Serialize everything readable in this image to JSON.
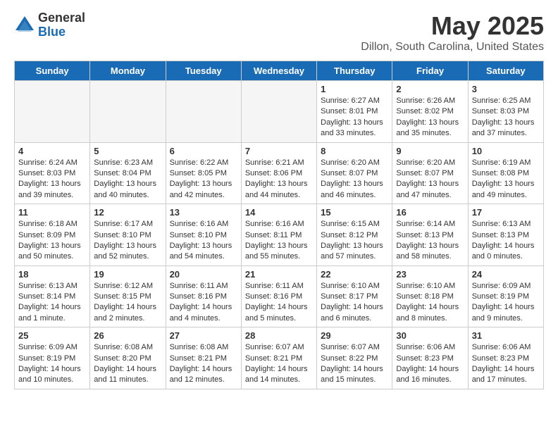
{
  "logo": {
    "general": "General",
    "blue": "Blue"
  },
  "header": {
    "title": "May 2025",
    "subtitle": "Dillon, South Carolina, United States"
  },
  "weekdays": [
    "Sunday",
    "Monday",
    "Tuesday",
    "Wednesday",
    "Thursday",
    "Friday",
    "Saturday"
  ],
  "weeks": [
    [
      {
        "day": "",
        "detail": ""
      },
      {
        "day": "",
        "detail": ""
      },
      {
        "day": "",
        "detail": ""
      },
      {
        "day": "",
        "detail": ""
      },
      {
        "day": "1",
        "detail": "Sunrise: 6:27 AM\nSunset: 8:01 PM\nDaylight: 13 hours\nand 33 minutes."
      },
      {
        "day": "2",
        "detail": "Sunrise: 6:26 AM\nSunset: 8:02 PM\nDaylight: 13 hours\nand 35 minutes."
      },
      {
        "day": "3",
        "detail": "Sunrise: 6:25 AM\nSunset: 8:03 PM\nDaylight: 13 hours\nand 37 minutes."
      }
    ],
    [
      {
        "day": "4",
        "detail": "Sunrise: 6:24 AM\nSunset: 8:03 PM\nDaylight: 13 hours\nand 39 minutes."
      },
      {
        "day": "5",
        "detail": "Sunrise: 6:23 AM\nSunset: 8:04 PM\nDaylight: 13 hours\nand 40 minutes."
      },
      {
        "day": "6",
        "detail": "Sunrise: 6:22 AM\nSunset: 8:05 PM\nDaylight: 13 hours\nand 42 minutes."
      },
      {
        "day": "7",
        "detail": "Sunrise: 6:21 AM\nSunset: 8:06 PM\nDaylight: 13 hours\nand 44 minutes."
      },
      {
        "day": "8",
        "detail": "Sunrise: 6:20 AM\nSunset: 8:07 PM\nDaylight: 13 hours\nand 46 minutes."
      },
      {
        "day": "9",
        "detail": "Sunrise: 6:20 AM\nSunset: 8:07 PM\nDaylight: 13 hours\nand 47 minutes."
      },
      {
        "day": "10",
        "detail": "Sunrise: 6:19 AM\nSunset: 8:08 PM\nDaylight: 13 hours\nand 49 minutes."
      }
    ],
    [
      {
        "day": "11",
        "detail": "Sunrise: 6:18 AM\nSunset: 8:09 PM\nDaylight: 13 hours\nand 50 minutes."
      },
      {
        "day": "12",
        "detail": "Sunrise: 6:17 AM\nSunset: 8:10 PM\nDaylight: 13 hours\nand 52 minutes."
      },
      {
        "day": "13",
        "detail": "Sunrise: 6:16 AM\nSunset: 8:10 PM\nDaylight: 13 hours\nand 54 minutes."
      },
      {
        "day": "14",
        "detail": "Sunrise: 6:16 AM\nSunset: 8:11 PM\nDaylight: 13 hours\nand 55 minutes."
      },
      {
        "day": "15",
        "detail": "Sunrise: 6:15 AM\nSunset: 8:12 PM\nDaylight: 13 hours\nand 57 minutes."
      },
      {
        "day": "16",
        "detail": "Sunrise: 6:14 AM\nSunset: 8:13 PM\nDaylight: 13 hours\nand 58 minutes."
      },
      {
        "day": "17",
        "detail": "Sunrise: 6:13 AM\nSunset: 8:13 PM\nDaylight: 14 hours\nand 0 minutes."
      }
    ],
    [
      {
        "day": "18",
        "detail": "Sunrise: 6:13 AM\nSunset: 8:14 PM\nDaylight: 14 hours\nand 1 minute."
      },
      {
        "day": "19",
        "detail": "Sunrise: 6:12 AM\nSunset: 8:15 PM\nDaylight: 14 hours\nand 2 minutes."
      },
      {
        "day": "20",
        "detail": "Sunrise: 6:11 AM\nSunset: 8:16 PM\nDaylight: 14 hours\nand 4 minutes."
      },
      {
        "day": "21",
        "detail": "Sunrise: 6:11 AM\nSunset: 8:16 PM\nDaylight: 14 hours\nand 5 minutes."
      },
      {
        "day": "22",
        "detail": "Sunrise: 6:10 AM\nSunset: 8:17 PM\nDaylight: 14 hours\nand 6 minutes."
      },
      {
        "day": "23",
        "detail": "Sunrise: 6:10 AM\nSunset: 8:18 PM\nDaylight: 14 hours\nand 8 minutes."
      },
      {
        "day": "24",
        "detail": "Sunrise: 6:09 AM\nSunset: 8:19 PM\nDaylight: 14 hours\nand 9 minutes."
      }
    ],
    [
      {
        "day": "25",
        "detail": "Sunrise: 6:09 AM\nSunset: 8:19 PM\nDaylight: 14 hours\nand 10 minutes."
      },
      {
        "day": "26",
        "detail": "Sunrise: 6:08 AM\nSunset: 8:20 PM\nDaylight: 14 hours\nand 11 minutes."
      },
      {
        "day": "27",
        "detail": "Sunrise: 6:08 AM\nSunset: 8:21 PM\nDaylight: 14 hours\nand 12 minutes."
      },
      {
        "day": "28",
        "detail": "Sunrise: 6:07 AM\nSunset: 8:21 PM\nDaylight: 14 hours\nand 14 minutes."
      },
      {
        "day": "29",
        "detail": "Sunrise: 6:07 AM\nSunset: 8:22 PM\nDaylight: 14 hours\nand 15 minutes."
      },
      {
        "day": "30",
        "detail": "Sunrise: 6:06 AM\nSunset: 8:23 PM\nDaylight: 14 hours\nand 16 minutes."
      },
      {
        "day": "31",
        "detail": "Sunrise: 6:06 AM\nSunset: 8:23 PM\nDaylight: 14 hours\nand 17 minutes."
      }
    ]
  ]
}
